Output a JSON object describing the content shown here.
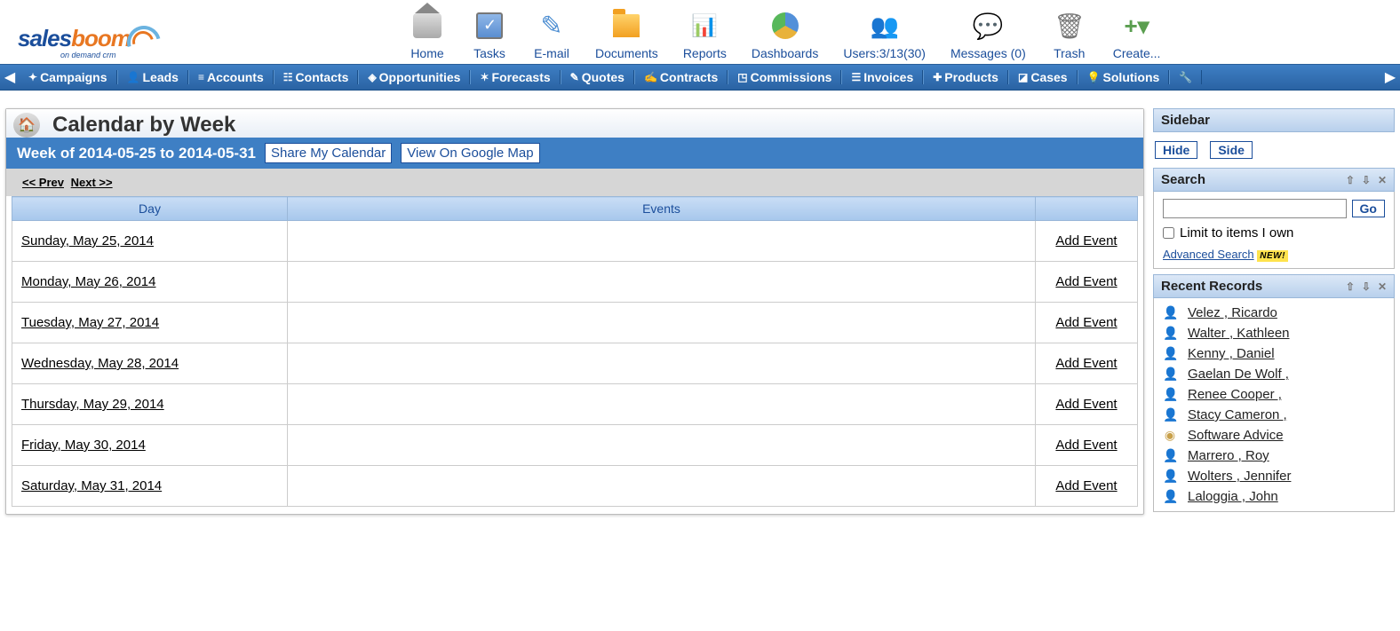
{
  "logo": {
    "part1": "sales",
    "part2": "boom",
    "sub": "on demand crm"
  },
  "toolbar": [
    {
      "id": "home",
      "label": "Home"
    },
    {
      "id": "tasks",
      "label": "Tasks"
    },
    {
      "id": "email",
      "label": "E-mail"
    },
    {
      "id": "documents",
      "label": "Documents"
    },
    {
      "id": "reports",
      "label": "Reports"
    },
    {
      "id": "dashboards",
      "label": "Dashboards"
    },
    {
      "id": "users",
      "label": "Users:3/13(30)"
    },
    {
      "id": "messages",
      "label": "Messages (0)"
    },
    {
      "id": "trash",
      "label": "Trash"
    },
    {
      "id": "create",
      "label": "Create..."
    }
  ],
  "nav": [
    "Campaigns",
    "Leads",
    "Accounts",
    "Contacts",
    "Opportunities",
    "Forecasts",
    "Quotes",
    "Contracts",
    "Commissions",
    "Invoices",
    "Products",
    "Cases",
    "Solutions"
  ],
  "page": {
    "title": "Calendar by Week",
    "week_range": "Week of 2014-05-25 to 2014-05-31",
    "share_btn": "Share My Calendar",
    "map_btn": "View On Google Map",
    "prev": "<< Prev",
    "next": "Next >>",
    "col_day": "Day",
    "col_events": "Events",
    "add_event": "Add Event",
    "days": [
      "Sunday, May 25, 2014",
      "Monday, May 26, 2014",
      "Tuesday, May 27, 2014",
      "Wednesday, May 28, 2014",
      "Thursday, May 29, 2014",
      "Friday, May 30, 2014",
      "Saturday, May 31, 2014"
    ]
  },
  "sidebar": {
    "title": "Sidebar",
    "hide": "Hide",
    "side": "Side",
    "search_title": "Search",
    "go": "Go",
    "limit_label": "Limit to items I own",
    "advanced": "Advanced Search",
    "new_badge": "NEW!",
    "recent_title": "Recent Records",
    "recent": [
      {
        "name": "Velez , Ricardo",
        "type": "person"
      },
      {
        "name": "Walter , Kathleen",
        "type": "person"
      },
      {
        "name": "Kenny , Daniel",
        "type": "person"
      },
      {
        "name": "Gaelan De Wolf ,",
        "type": "person"
      },
      {
        "name": "Renee Cooper ,",
        "type": "person"
      },
      {
        "name": "Stacy Cameron ,",
        "type": "person"
      },
      {
        "name": "Software Advice",
        "type": "org"
      },
      {
        "name": "Marrero , Roy",
        "type": "person"
      },
      {
        "name": "Wolters , Jennifer",
        "type": "person"
      },
      {
        "name": "Laloggia , John",
        "type": "person"
      }
    ]
  }
}
